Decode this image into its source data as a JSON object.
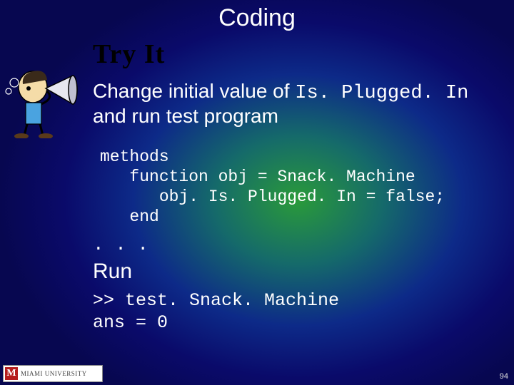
{
  "title": "Coding",
  "heading": "Try It",
  "description": {
    "pre": "Change initial value of ",
    "code": "Is. Plugged. In",
    "post": " and run test program"
  },
  "code_block": "methods\n   function obj = Snack. Machine\n      obj. Is. Plugged. In = false;\n   end",
  "ellipsis": ". . .",
  "run_label": "Run",
  "repl_block": ">> test. Snack. Machine\nans = 0",
  "footer": {
    "logo_letter": "M",
    "logo_text": "MIAMI UNIVERSITY"
  },
  "page_number": "94"
}
